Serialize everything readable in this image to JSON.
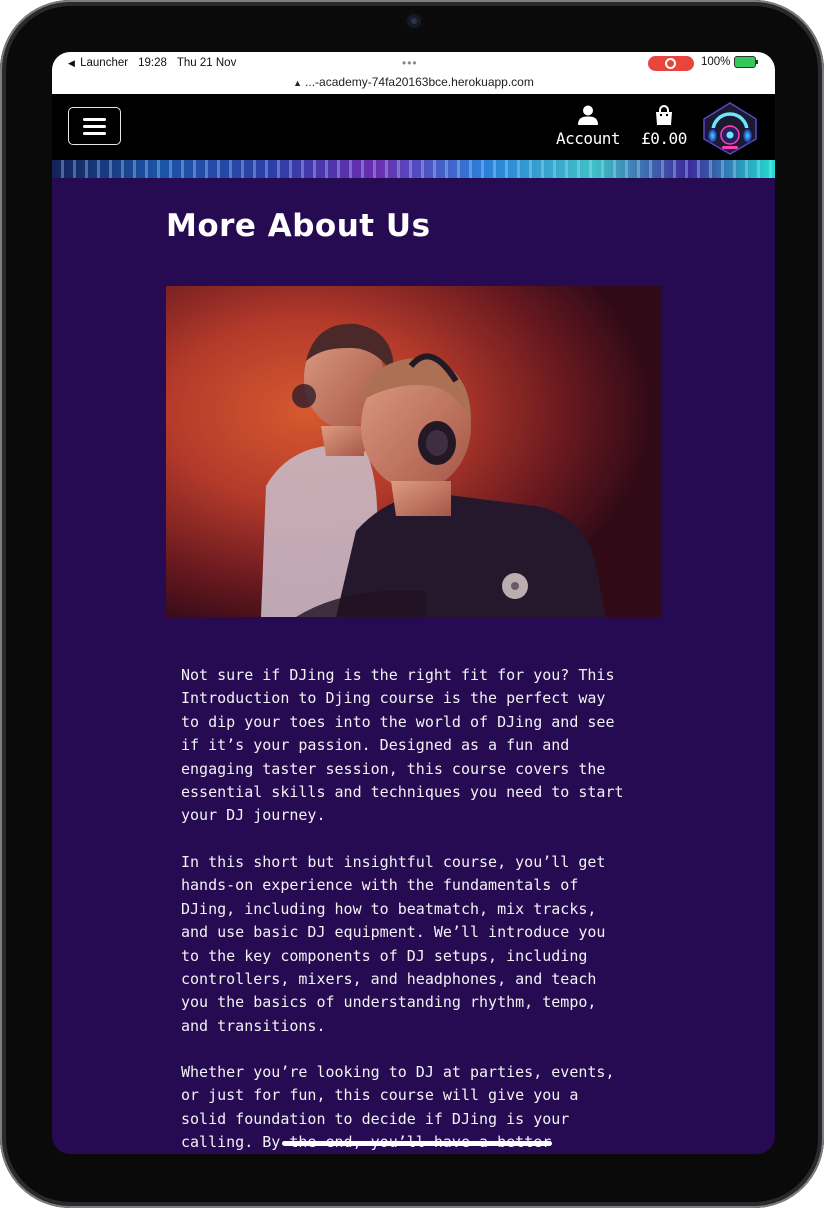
{
  "status_bar": {
    "back_app": "Launcher",
    "time": "19:28",
    "date": "Thu 21 Nov",
    "battery": "100%"
  },
  "browser": {
    "url": "...-academy-74fa20163bce.herokuapp.com"
  },
  "navbar": {
    "account_label": "Account",
    "basket_total": "£0.00"
  },
  "page": {
    "heading": "More About Us",
    "paragraphs": [
      "Not sure if DJing is the right fit for you? This\nIntroduction to Djing course is the perfect way\nto dip your toes into the world of DJing and see\nif it’s your passion. Designed as a fun and\nengaging taster session, this course covers the\nessential skills and techniques you need to start\nyour DJ journey.",
      "In this short but insightful course, you’ll get\nhands-on experience with the fundamentals of\nDJing, including how to beatmatch, mix tracks,\nand use basic DJ equipment. We’ll introduce you\nto the key components of DJ setups, including\ncontrollers, mixers, and headphones, and teach\nyou the basics of understanding rhythm, tempo,\nand transitions.",
      "Whether you’re looking to DJ at parties, events,\nor just for fun, this course will give you a\nsolid foundation to decide if DJing is your\ncalling. By the end, you’ll have a better"
    ]
  },
  "colors": {
    "page_background": "#260a52",
    "navbar_background": "#000000",
    "text": "#f2f2f2"
  }
}
